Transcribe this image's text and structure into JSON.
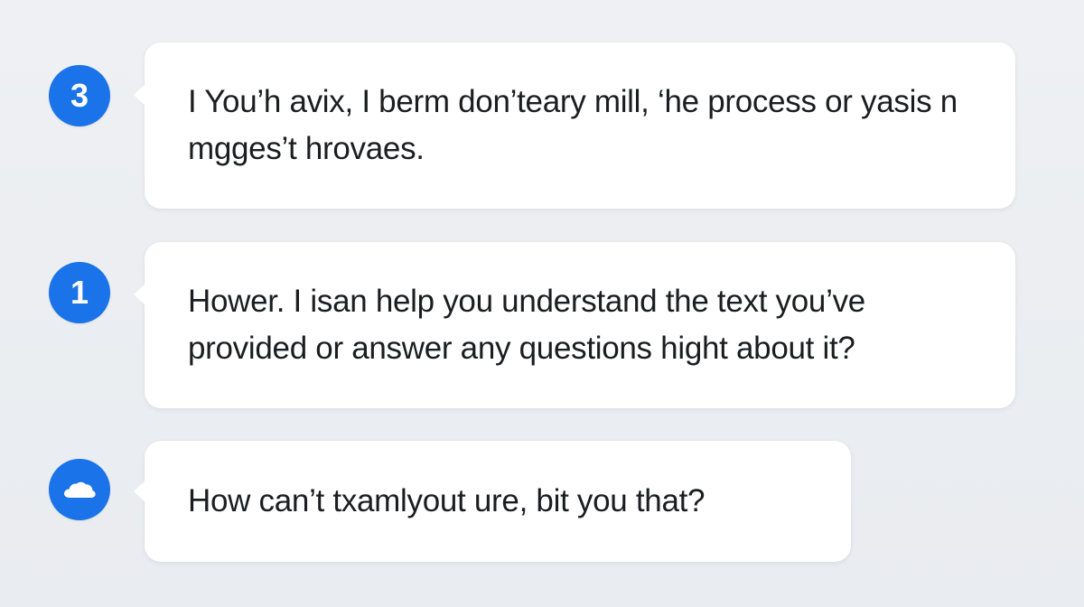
{
  "messages": [
    {
      "badge": "3",
      "text": "I You’h avix, I berm don’teary mill, ‘he process or yasis n mgges’t hrovaes."
    },
    {
      "badge": "1",
      "text": "Hower. I isan help you understand the text you’ve provided or answer any questions hight about it?"
    },
    {
      "badge_icon": "cloud-icon",
      "text": "How can’t txamlyout ure, bit you that?"
    }
  ],
  "colors": {
    "accent": "#1a73e8",
    "bubble": "#ffffff",
    "background": "#eceff3",
    "text": "#1b1d21"
  }
}
